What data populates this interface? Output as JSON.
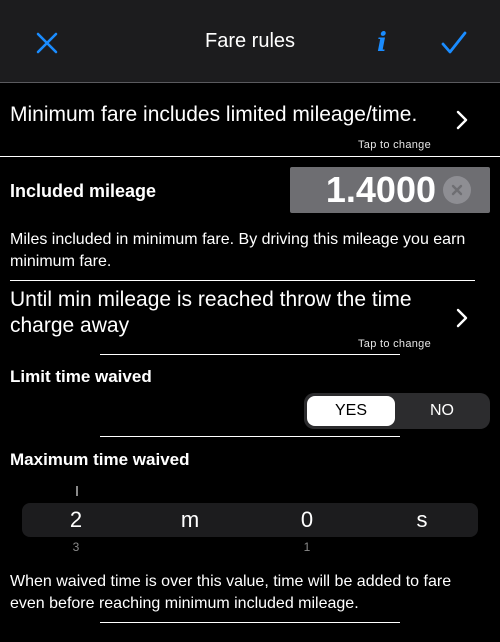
{
  "nav": {
    "title": "Fare rules",
    "close_icon": "close-icon",
    "info_label": "i",
    "done_icon": "checkmark-icon",
    "accent_color": "#1a8cff"
  },
  "fare_mode": {
    "label": "Minimum fare includes limited mileage/time.",
    "hint": "Tap to change"
  },
  "included_mileage": {
    "label": "Included mileage",
    "value": "1.4000",
    "description": "Miles included in minimum fare. By driving this mileage you earn minimum fare."
  },
  "time_charge": {
    "label": "Until min mileage is reached throw the time charge away",
    "hint": "Tap to change"
  },
  "limit_time": {
    "label": "Limit time waived",
    "options": [
      "YES",
      "NO"
    ],
    "selected": "YES"
  },
  "max_time": {
    "label": "Maximum time waived",
    "minutes_value": "2",
    "minutes_unit": "m",
    "seconds_value": "0",
    "seconds_unit": "s",
    "minutes_prev": "1",
    "minutes_next": "3",
    "seconds_next": "1",
    "description": "When waived time is over this value, time will be added to fare even before reaching minimum included mileage."
  }
}
